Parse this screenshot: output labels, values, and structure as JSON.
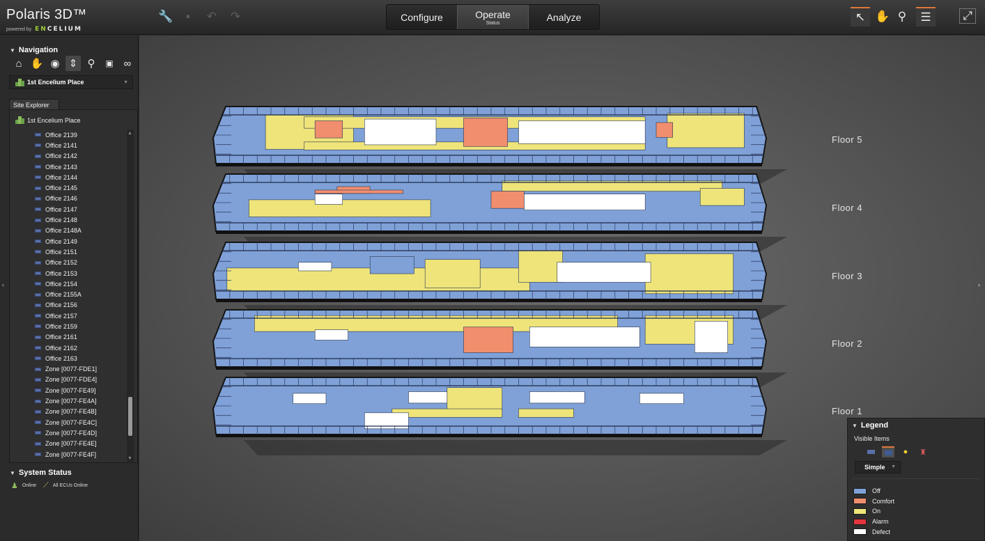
{
  "app": {
    "title": "Polaris 3D™",
    "powered_by": "powered by",
    "brand_a": "EN",
    "brand_b": "CELIUM"
  },
  "toolbar": [
    {
      "name": "wrench-icon",
      "glyph": "🔧",
      "enabled": true
    },
    {
      "name": "save-icon",
      "glyph": "▪",
      "enabled": false
    },
    {
      "name": "undo-icon",
      "glyph": "↶",
      "enabled": false
    },
    {
      "name": "redo-icon",
      "glyph": "↷",
      "enabled": false
    }
  ],
  "mode_tabs": [
    {
      "label": "Configure",
      "sublabel": "",
      "active": false
    },
    {
      "label": "Operate",
      "sublabel": "Status",
      "active": true
    },
    {
      "label": "Analyze",
      "sublabel": "",
      "active": false
    }
  ],
  "right_tools": [
    {
      "name": "select-pointer-icon",
      "glyph": "↖",
      "selected": true
    },
    {
      "name": "pan-hand-icon",
      "glyph": "✋",
      "selected": false
    },
    {
      "name": "zoom-icon",
      "glyph": "⚲",
      "selected": false
    },
    {
      "name": "checklist-icon",
      "glyph": "☰",
      "selected": true
    },
    {
      "name": "fullscreen-icon",
      "glyph": "⤢",
      "selected": false
    }
  ],
  "navigation": {
    "title": "Navigation",
    "icons": [
      {
        "name": "home-icon",
        "glyph": "⌂",
        "selected": false
      },
      {
        "name": "hand-icon",
        "glyph": "✋",
        "selected": false
      },
      {
        "name": "orbit-eye-icon",
        "glyph": "◉",
        "selected": false
      },
      {
        "name": "vertical-move-icon",
        "glyph": "⇕",
        "selected": true
      },
      {
        "name": "zoom-icon",
        "glyph": "⚲",
        "selected": false
      },
      {
        "name": "view-2d-icon",
        "glyph": "▣",
        "selected": false
      },
      {
        "name": "binoculars-icon",
        "glyph": "∞",
        "selected": false
      }
    ],
    "site": "1st Encelium Place"
  },
  "site_explorer": {
    "tab": "Site Explorer",
    "root": "1st Encelium Place",
    "items": [
      "Office 2139",
      "Office 2141",
      "Office 2142",
      "Office 2143",
      "Office 2144",
      "Office 2145",
      "Office 2146",
      "Office 2147",
      "Office 2148",
      "Office 2148A",
      "Office 2149",
      "Office 2151",
      "Office 2152",
      "Office 2153",
      "Office 2154",
      "Office 2155A",
      "Office 2156",
      "Office 2157",
      "Office 2159",
      "Office 2161",
      "Office 2162",
      "Office 2163",
      "Zone [0077-FDE1]",
      "Zone [0077-FDE4]",
      "Zone [0077-FE49]",
      "Zone [0077-FE4A]",
      "Zone [0077-FE4B]",
      "Zone [0077-FE4C]",
      "Zone [0077-FE4D]",
      "Zone [0077-FE4E]",
      "Zone [0077-FE4F]"
    ]
  },
  "system_status": {
    "title": "System Status",
    "online": "Online",
    "ecus": "All ECUs Online"
  },
  "floors": [
    {
      "label": "Floor 5",
      "scheme": "f5"
    },
    {
      "label": "Floor 4",
      "scheme": "f4"
    },
    {
      "label": "Floor 3",
      "scheme": "f3"
    },
    {
      "label": "Floor 2",
      "scheme": "f2"
    },
    {
      "label": "Floor 1",
      "scheme": "f1"
    }
  ],
  "legend": {
    "title": "Legend",
    "visible_items": "Visible Items",
    "mode": "Simple",
    "entries": [
      {
        "label": "Off",
        "color": "#7fa1d7"
      },
      {
        "label": "Comfort",
        "color": "#f08e6e"
      },
      {
        "label": "On",
        "color": "#eee47a"
      },
      {
        "label": "Alarm",
        "color": "#e2343e"
      },
      {
        "label": "Defect",
        "color": "#ffffff"
      }
    ]
  },
  "colors": {
    "off": "#7fa1d7",
    "comfort": "#f08e6e",
    "on": "#eee47a",
    "defect": "#ffffff",
    "accent": "#e0783a"
  }
}
